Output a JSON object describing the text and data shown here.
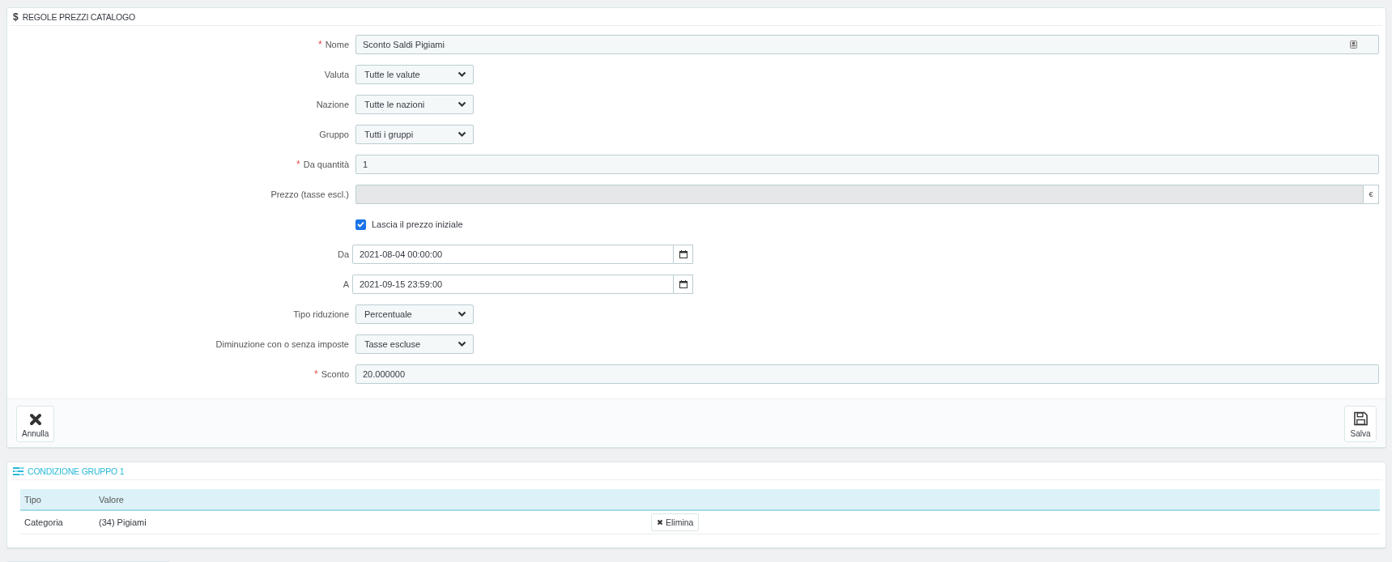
{
  "rule_panel": {
    "title_icon": "$",
    "title": "REGOLE PREZZI CATALOGO",
    "fields": [
      {
        "kind": "translatable",
        "marker": "*",
        "label": "Nome",
        "value": "Sconto Saldi Pigiami"
      },
      {
        "kind": "select",
        "label": "Valuta",
        "value": "Tutte le valute"
      },
      {
        "kind": "select",
        "label": "Nazione",
        "value": "Tutte le nazioni"
      },
      {
        "kind": "select",
        "label": "Gruppo",
        "value": "Tutti i gruppi"
      },
      {
        "kind": "text",
        "marker": "*",
        "label": "Da quantità",
        "value": "1"
      },
      {
        "kind": "addon",
        "label": "Prezzo (tasse escl.)",
        "disabled": true,
        "addon": "€"
      },
      {
        "kind": "checkbox",
        "label": "Lascia il prezzo iniziale",
        "checked": true
      },
      {
        "kind": "date",
        "label": "Da",
        "value": "2021-08-04 00:00:00"
      },
      {
        "kind": "date",
        "label": "A",
        "value": "2021-09-15 23:59:00"
      },
      {
        "kind": "select",
        "label": "Tipo riduzione",
        "value": "Percentuale"
      },
      {
        "kind": "select",
        "label": "Diminuzione con o senza imposte",
        "value": "Tasse escluse"
      },
      {
        "kind": "text",
        "marker": "*",
        "label": "Sconto",
        "value": "20.000000"
      }
    ],
    "cancel_button": "Annulla",
    "save_button": "Salva"
  },
  "condition_panel": {
    "title": "CONDIZIONE GRUPPO 1",
    "table": {
      "columns": [
        "Tipo",
        "Valore"
      ],
      "rows": [
        {
          "cells": [
            "Categoria",
            "(34) Pigiami"
          ],
          "action": "Elimina"
        }
      ]
    }
  }
}
